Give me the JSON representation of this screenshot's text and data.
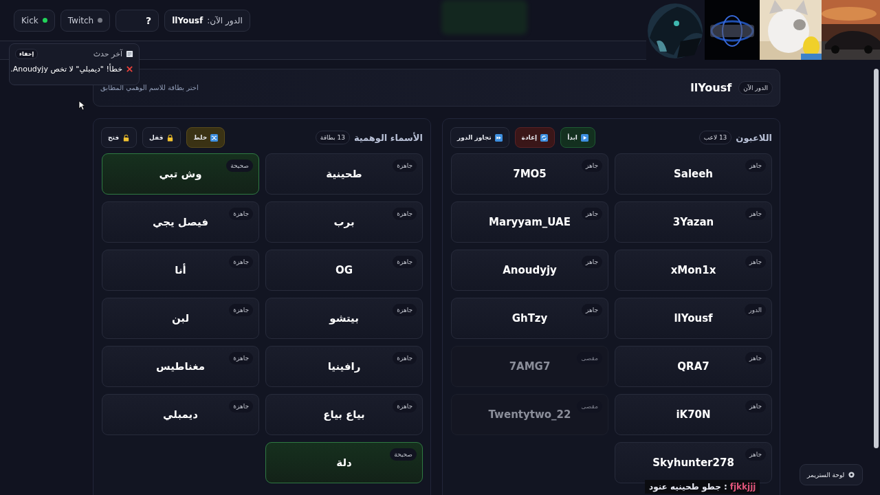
{
  "top_bar": {
    "turn_text": "الدور الآن: **llYousf**",
    "help": "?",
    "platforms": [
      {
        "name": "Twitch",
        "on": false
      },
      {
        "name": "Kick",
        "on": true
      }
    ]
  },
  "toast": {
    "title": "آخر حدث",
    "hide": "إخفاء",
    "message": "خطأ! \"ديمبلي\" لا تخص Anoudyjy."
  },
  "header": {
    "badge": "الدور الآن",
    "player": "llYousf",
    "hint": "اختر بطاقة للاسم الوهمي المطابق"
  },
  "players": {
    "title": "اللاعبون",
    "count": "13 لاعب",
    "buttons": [
      {
        "label": "ابدأ",
        "kind": "start"
      },
      {
        "label": "إعادة",
        "kind": "reset"
      },
      {
        "label": "تجاوز الدور",
        "kind": "skip"
      }
    ],
    "cards": [
      {
        "name": "Saleeh",
        "status": "جاهز",
        "kind": "normal"
      },
      {
        "name": "7MO5",
        "status": "جاهز",
        "kind": "normal"
      },
      {
        "name": "3Yazan",
        "status": "جاهز",
        "kind": "normal"
      },
      {
        "name": "Maryyam_UAE",
        "status": "جاهز",
        "kind": "normal"
      },
      {
        "name": "xMon1x",
        "status": "جاهز",
        "kind": "normal"
      },
      {
        "name": "Anoudyjy",
        "status": "جاهز",
        "kind": "normal"
      },
      {
        "name": "llYousf",
        "status": "الدور",
        "kind": "normal"
      },
      {
        "name": "GhTzy",
        "status": "جاهز",
        "kind": "normal"
      },
      {
        "name": "QRA7",
        "status": "جاهز",
        "kind": "normal"
      },
      {
        "name": "7AMG7",
        "status": "مقصى",
        "kind": "excluded"
      },
      {
        "name": "iK70N",
        "status": "جاهز",
        "kind": "normal"
      },
      {
        "name": "Twentytwo_22",
        "status": "مقصى",
        "kind": "excluded"
      },
      {
        "name": "Skyhunter278",
        "status": "جاهز",
        "kind": "normal"
      }
    ]
  },
  "names": {
    "title": "الأسماء الوهمية",
    "count": "13 بطاقة",
    "buttons": [
      {
        "label": "خلط",
        "kind": "shuffle"
      },
      {
        "label": "قفل",
        "kind": "lock"
      },
      {
        "label": "فتح",
        "kind": "unlock"
      }
    ],
    "cards": [
      {
        "name": "طحينية",
        "status": "جاهزة",
        "kind": "normal"
      },
      {
        "name": "وش تبي",
        "status": "صحيحة",
        "kind": "correct"
      },
      {
        "name": "برب",
        "status": "جاهزة",
        "kind": "normal"
      },
      {
        "name": "فيصل يجي",
        "status": "جاهزة",
        "kind": "normal"
      },
      {
        "name": "OG",
        "status": "جاهزة",
        "kind": "normal"
      },
      {
        "name": "أنا",
        "status": "جاهزة",
        "kind": "normal"
      },
      {
        "name": "بيتشو",
        "status": "جاهزة",
        "kind": "normal"
      },
      {
        "name": "لبن",
        "status": "جاهزة",
        "kind": "normal"
      },
      {
        "name": "رافينيا",
        "status": "جاهزة",
        "kind": "normal"
      },
      {
        "name": "مغناطيس",
        "status": "جاهزة",
        "kind": "normal"
      },
      {
        "name": "بياع بياع",
        "status": "جاهزة",
        "kind": "normal"
      },
      {
        "name": "ديمبلي",
        "status": "جاهزة",
        "kind": "normal"
      },
      {
        "name": "دلة",
        "status": "صحيحة",
        "kind": "correct"
      }
    ]
  },
  "streamer_button": "لوحة الستريمر",
  "chat": {
    "user": "fjkkjjj",
    "separator": ":",
    "message": "جطو طحينيه عنود"
  }
}
